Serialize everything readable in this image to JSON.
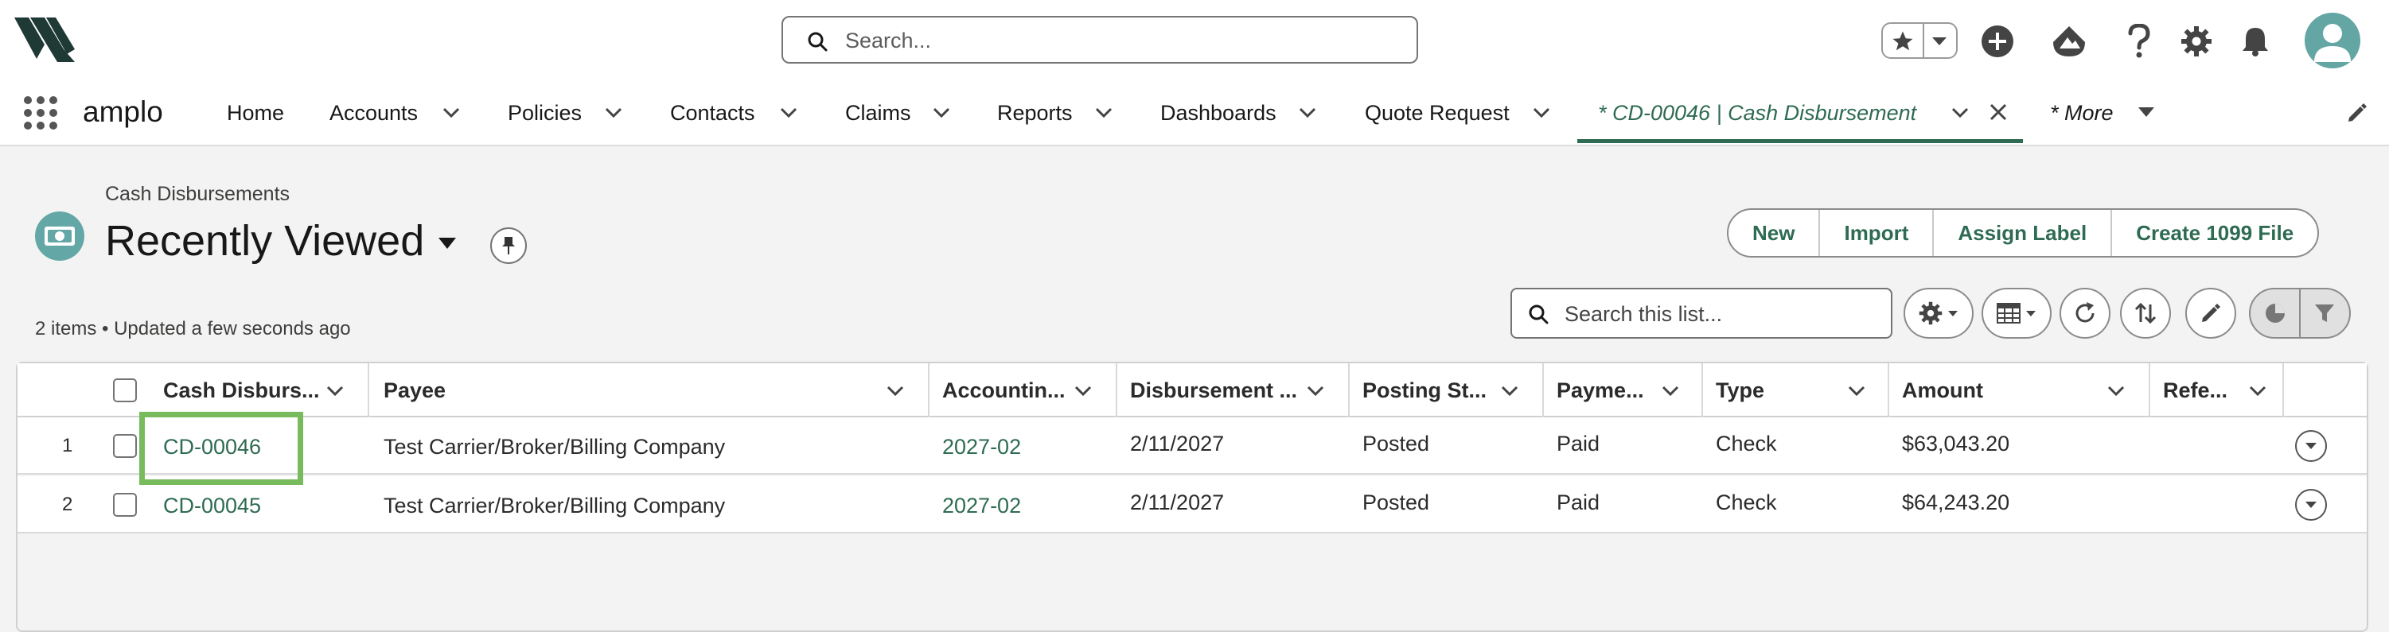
{
  "header": {
    "search_placeholder": "Search..."
  },
  "app": {
    "name": "amplo"
  },
  "nav": {
    "items": [
      {
        "label": "Home"
      },
      {
        "label": "Accounts"
      },
      {
        "label": "Policies"
      },
      {
        "label": "Contacts"
      },
      {
        "label": "Claims"
      },
      {
        "label": "Reports"
      },
      {
        "label": "Dashboards"
      },
      {
        "label": "Quote Request"
      }
    ],
    "active_tab": "* CD-00046 | Cash Disbursement",
    "more_label": "* More"
  },
  "page": {
    "object_label": "Cash Disbursements",
    "list_view": "Recently Viewed",
    "meta": "2 items • Updated a few seconds ago",
    "actions": [
      "New",
      "Import",
      "Assign Label",
      "Create 1099 File"
    ],
    "list_search_placeholder": "Search this list..."
  },
  "table": {
    "columns": [
      "Cash Disburs...",
      "Payee",
      "Accountin...",
      "Disbursement ...",
      "Posting St...",
      "Payme...",
      "Type",
      "Amount",
      "Refe..."
    ],
    "rows": [
      {
        "num": "1",
        "name": "CD-00046",
        "payee": "Test Carrier/Broker/Billing Company",
        "period": "2027-02",
        "date": "2/11/2027",
        "posting": "Posted",
        "payment": "Paid",
        "type": "Check",
        "amount": "$63,043.20",
        "ref": ""
      },
      {
        "num": "2",
        "name": "CD-00045",
        "payee": "Test Carrier/Broker/Billing Company",
        "period": "2027-02",
        "date": "2/11/2027",
        "posting": "Posted",
        "payment": "Paid",
        "type": "Check",
        "amount": "$64,243.20",
        "ref": ""
      }
    ]
  },
  "colors": {
    "brand_green": "#2e6b52",
    "object_icon": "#63a7a6",
    "highlight": "#78bb5c"
  }
}
